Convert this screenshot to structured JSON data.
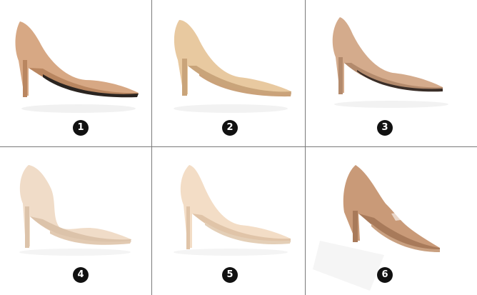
{
  "products": [
    {
      "number": "1",
      "icon": "pointed-toe-pump",
      "color": "#d7a884",
      "shade": "#b98660",
      "sole": "#2a2420"
    },
    {
      "number": "2",
      "icon": "pointed-toe-pump",
      "color": "#e8c9a0",
      "shade": "#c9a47a",
      "sole": "#caa27a"
    },
    {
      "number": "3",
      "icon": "suede-pointed-toe-pump",
      "color": "#d4ab8c",
      "shade": "#b38a6c",
      "sole": "#3a2e28"
    },
    {
      "number": "4",
      "icon": "dorsay-pump",
      "color": "#f0dcc8",
      "shade": "#dcc3aa",
      "sole": "#e2cab2"
    },
    {
      "number": "5",
      "icon": "suede-pointed-toe-pump",
      "color": "#f3ddc6",
      "shade": "#e0c4a8",
      "sole": "#e4cfb7"
    },
    {
      "number": "6",
      "icon": "cut-out-pointed-pump",
      "color": "#c99a78",
      "shade": "#a87a5a",
      "sole": "#c9a080"
    }
  ]
}
